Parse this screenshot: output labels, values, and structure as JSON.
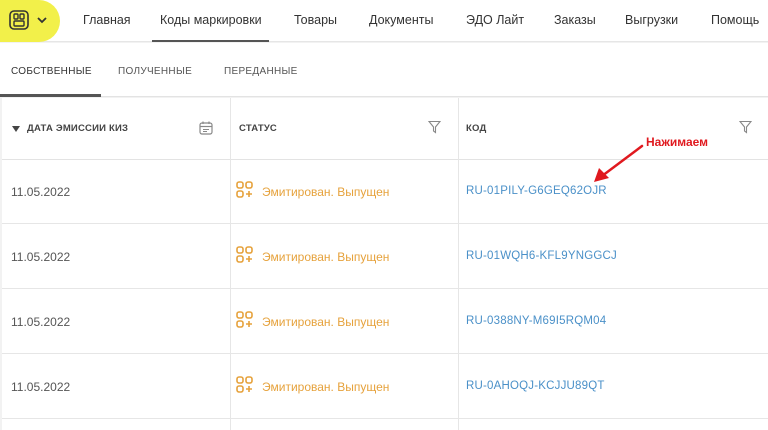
{
  "nav": {
    "items": [
      "Главная",
      "Коды маркировки",
      "Товары",
      "Документы",
      "ЭДО Лайт",
      "Заказы",
      "Выгрузки",
      "Помощь"
    ],
    "active": "Коды маркировки"
  },
  "subtabs": {
    "items": [
      "СОБСТВЕННЫЕ",
      "ПОЛУЧЕННЫЕ",
      "ПЕРЕДАННЫЕ"
    ],
    "active": "СОБСТВЕННЫЕ"
  },
  "table": {
    "headers": {
      "date": "ДАТА ЭМИССИИ КИЗ",
      "status": "СТАТУС",
      "code": "КОД"
    },
    "rows": [
      {
        "date": "11.05.2022",
        "status": "Эмитирован. Выпущен",
        "code": "RU-01PILY-G6GEQ62OJR"
      },
      {
        "date": "11.05.2022",
        "status": "Эмитирован. Выпущен",
        "code": "RU-01WQH6-KFL9YNGGCJ"
      },
      {
        "date": "11.05.2022",
        "status": "Эмитирован. Выпущен",
        "code": "RU-0388NY-M69I5RQM04"
      },
      {
        "date": "11.05.2022",
        "status": "Эмитирован. Выпущен",
        "code": "RU-0AHOQJ-KCJJU89QT"
      }
    ]
  },
  "annotation": {
    "text": "Нажимаем",
    "color": "#e0191f"
  },
  "colors": {
    "status": "#e6a23c",
    "link": "#4a90c8",
    "logo_bg": "#f2f04a"
  },
  "icons": {
    "logo": "app-logo-icon",
    "chevron": "chevron-down-icon",
    "calendar": "calendar-icon",
    "filter": "filter-icon",
    "status": "code-status-icon"
  }
}
